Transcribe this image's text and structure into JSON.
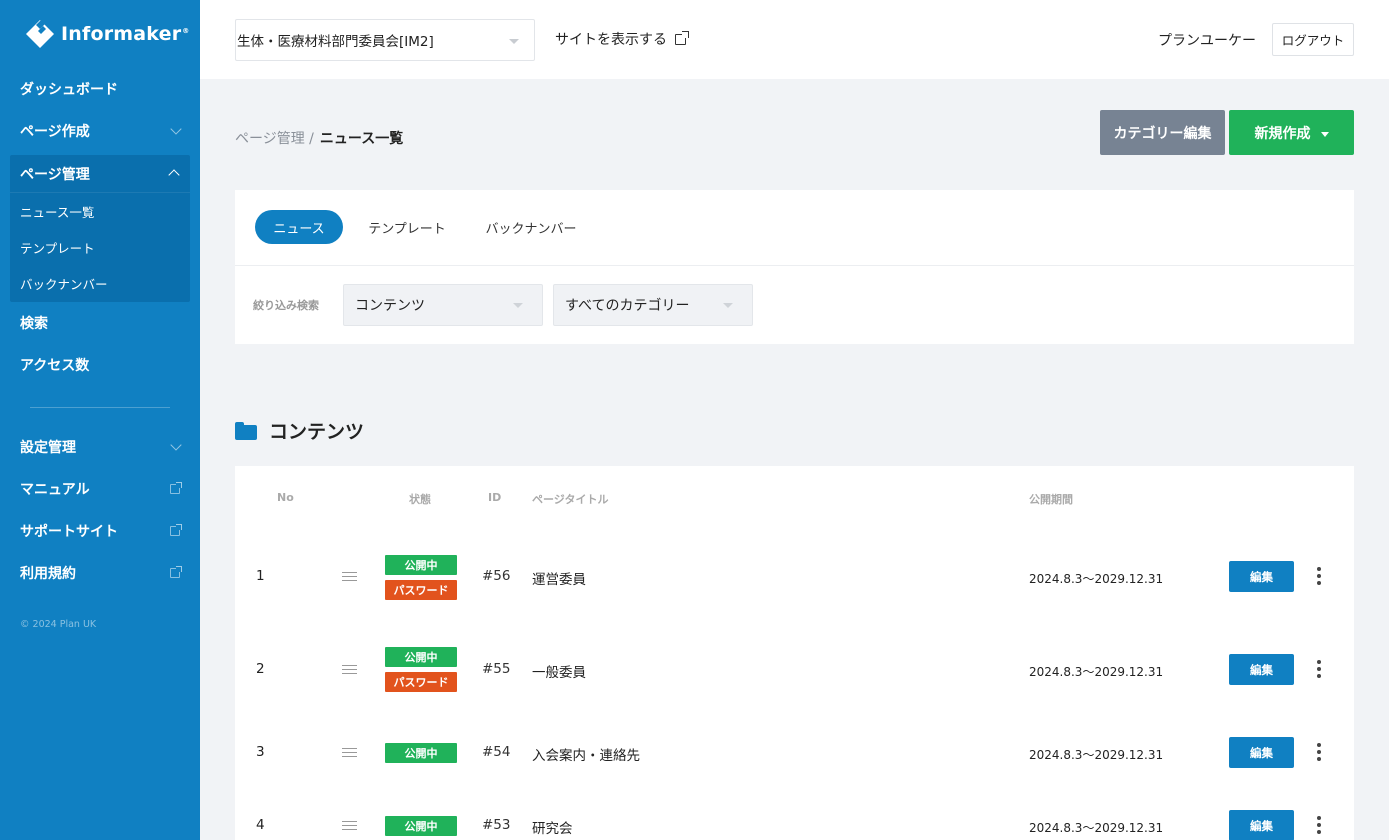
{
  "brand": {
    "name": "Informaker",
    "reg": "®",
    "accent": "#1080c2"
  },
  "sidebar": {
    "items": [
      {
        "label": "ダッシュボード"
      },
      {
        "label": "ページ作成"
      },
      {
        "label": "ページ管理"
      },
      {
        "label": "検索"
      },
      {
        "label": "アクセス数"
      },
      {
        "label": "設定管理"
      },
      {
        "label": "マニュアル"
      },
      {
        "label": "サポートサイト"
      },
      {
        "label": "利用規約"
      }
    ],
    "submenu": [
      {
        "label": "ニュース一覧"
      },
      {
        "label": "テンプレート"
      },
      {
        "label": "バックナンバー"
      }
    ],
    "copyright": "© 2024 Plan UK"
  },
  "header": {
    "site_select": "生体・医療材料部門委員会[IM2]",
    "view_site": "サイトを表示する",
    "user": "プランユーケー",
    "logout": "ログアウト"
  },
  "breadcrumb": {
    "parent": "ページ管理 /",
    "current": "ニュース一覧"
  },
  "actions": {
    "category_edit": "カテゴリー編集",
    "new": "新規作成"
  },
  "tabs": [
    {
      "label": "ニュース",
      "active": true
    },
    {
      "label": "テンプレート",
      "active": false
    },
    {
      "label": "バックナンバー",
      "active": false
    }
  ],
  "filter": {
    "label": "絞り込み検索",
    "content": "コンテンツ",
    "category": "すべてのカテゴリー"
  },
  "section": {
    "title": "コンテンツ"
  },
  "table": {
    "headers": {
      "no": "No",
      "status": "状態",
      "id": "ID",
      "title": "ページタイトル",
      "period": "公開期間"
    },
    "edit_label": "編集",
    "rows": [
      {
        "no": "1",
        "badges": [
          "公開中",
          "パスワード"
        ],
        "id": "#56",
        "title": "運営委員",
        "period": "2024.8.3～2029.12.31"
      },
      {
        "no": "2",
        "badges": [
          "公開中",
          "パスワード"
        ],
        "id": "#55",
        "title": "一般委員",
        "period": "2024.8.3～2029.12.31"
      },
      {
        "no": "3",
        "badges": [
          "公開中"
        ],
        "id": "#54",
        "title": "入会案内・連絡先",
        "period": "2024.8.3～2029.12.31"
      },
      {
        "no": "4",
        "badges": [
          "公開中"
        ],
        "id": "#53",
        "title": "研究会",
        "period": "2024.8.3～2029.12.31"
      }
    ]
  }
}
